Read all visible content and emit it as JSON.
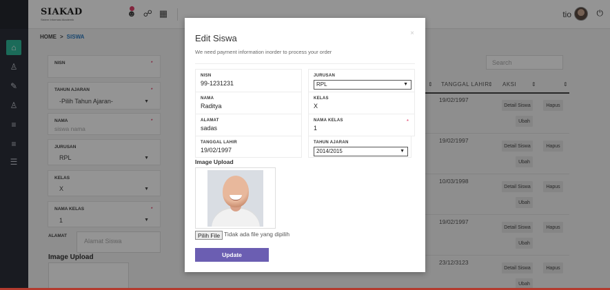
{
  "app": {
    "logo": "SIAKAD",
    "logo_sub": "Sistem Informasi Akademik"
  },
  "header": {
    "user": "tio",
    "icons": [
      "user-alert-icon",
      "link-icon",
      "grid-icon"
    ],
    "power_icon": "power-icon"
  },
  "sidebar": {
    "items": [
      "home-icon",
      "user-icon",
      "brush-icon",
      "user-icon",
      "list-icon",
      "list-icon",
      "list-icon"
    ]
  },
  "breadcrumb": {
    "home": "HOME",
    "sep": ">",
    "current": "SISWA"
  },
  "bg_form": {
    "nisn_label": "NISN",
    "tahun_label": "TAHUN AJARAN",
    "tahun_value": "-Pilih Tahun Ajaran-",
    "nama_label": "NAMA",
    "nama_placeholder": "siswa nama",
    "jurusan_label": "JURUSAN",
    "jurusan_value": "RPL",
    "kelas_label": "KELAS",
    "kelas_value": "X",
    "nama_kelas_label": "NAMA KELAS",
    "nama_kelas_value": "1",
    "alamat_label": "ALAMAT",
    "alamat_placeholder": "Alamat Siswa",
    "upload_title": "Image Upload",
    "required": "*"
  },
  "table": {
    "search_placeholder": "Search",
    "headers": [
      "TANGGAL LAHIR",
      "AKSI"
    ],
    "sort_icon": "⇕",
    "rows": [
      {
        "date": "19/02/1997",
        "detail": "Detail Siswa",
        "hapus": "Hapus",
        "ubah": "Ubah"
      },
      {
        "date": "19/02/1997",
        "detail": "Detail Siswa",
        "hapus": "Hapus",
        "ubah": "Ubah"
      },
      {
        "date": "10/03/1998",
        "detail": "Detail Siswa",
        "hapus": "Hapus",
        "ubah": "Ubah"
      },
      {
        "date": "19/02/1997",
        "detail": "Detail Siswa",
        "hapus": "Hapus",
        "ubah": "Ubah"
      },
      {
        "date": "23/12/3123",
        "detail": "Detail Siswa",
        "hapus": "Hapus",
        "ubah": "Ubah"
      }
    ]
  },
  "modal": {
    "title": "Edit Siswa",
    "close": "×",
    "subtitle": "We need payment information inorder to process your order",
    "nisn_label": "NISN",
    "nisn_value": "99-1231231",
    "jurusan_label": "JURUSAN",
    "jurusan_value": "RPL",
    "nama_label": "NAMA",
    "nama_value": "Raditya",
    "kelas_label": "KELAS",
    "kelas_value": "X",
    "alamat_label": "ALAMAT",
    "alamat_value": "sadas",
    "nama_kelas_label": "NAMA KELAS",
    "nama_kelas_value": "1",
    "tgl_label": "TANGGAL LAHIR",
    "tgl_value": "19/02/1997",
    "tahun_label": "TAHUN AJARAN",
    "tahun_value": "2014/2015",
    "required": "*",
    "upload_title": "Image Upload",
    "file_button": "Pilih File",
    "file_status": "Tidak ada file yang dipilih",
    "update_button": "Update"
  }
}
